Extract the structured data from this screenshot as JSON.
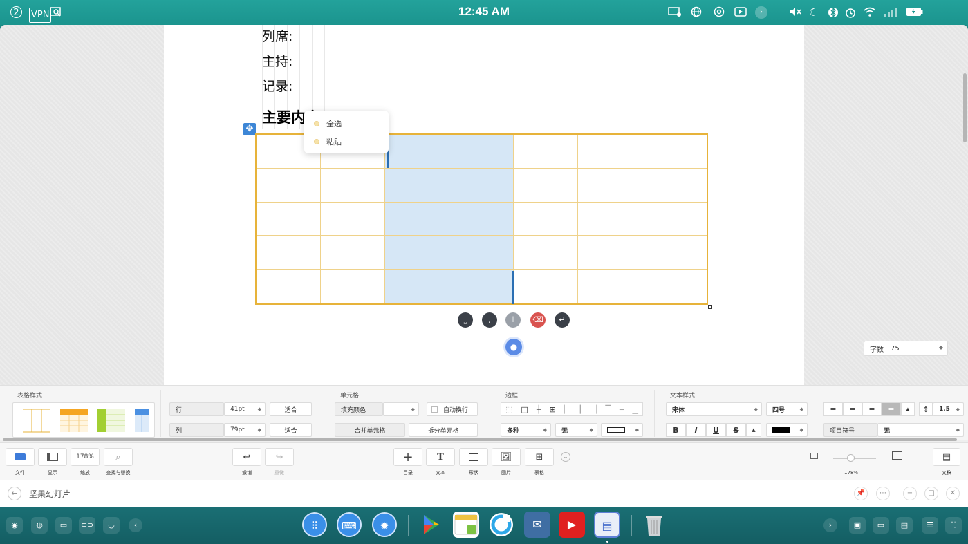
{
  "status_bar": {
    "time": "12:45 AM",
    "notif_count": "2",
    "vpn_label": "VPN"
  },
  "document": {
    "lines": [
      "列席:",
      "主持:",
      "记录:"
    ],
    "heading": "主要内容"
  },
  "context_menu": {
    "items": [
      "全选",
      "粘贴"
    ]
  },
  "word_count": {
    "label": "字数",
    "value": "75"
  },
  "properties": {
    "table_style": {
      "title": "表格样式"
    },
    "rows_cols": {
      "row_label": "行",
      "row_height": "41pt",
      "col_label": "列",
      "col_width": "79pt",
      "fit_label": "适合"
    },
    "cell": {
      "title": "单元格",
      "fill_color": "填充颜色",
      "auto_wrap": "自动换行",
      "merge": "合并单元格",
      "split": "拆分单元格"
    },
    "border": {
      "title": "边框",
      "style": "多种",
      "color": "无"
    },
    "text_style": {
      "title": "文本样式",
      "font": "宋体",
      "size": "四号",
      "bold": "B",
      "italic": "I",
      "underline": "U",
      "strike": "S",
      "line_spacing": "1.5",
      "bullet_label": "项目符号",
      "bullet_value": "无"
    }
  },
  "toolbar": {
    "file": "文件",
    "display": "显示",
    "zoom_value": "178%",
    "zoom_label": "缩放",
    "find": "查找与替换",
    "undo": "撤销",
    "redo": "重做",
    "toc": "目录",
    "text": "文本",
    "shape": "形状",
    "image": "图片",
    "table": "表格",
    "zoom_percent": "178%",
    "doc": "文稿"
  },
  "title_bar": {
    "app_title": "坚果幻灯片"
  },
  "colors": {
    "accent_teal": "#1d8a86",
    "table_border": "#e7b33a",
    "selection": "#d6e7f6"
  }
}
